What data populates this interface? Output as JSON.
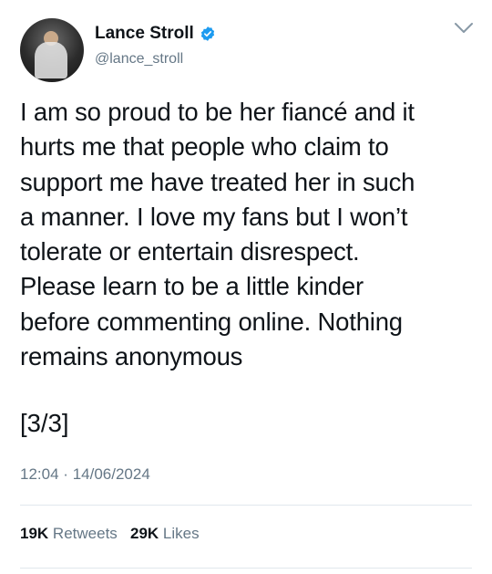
{
  "author": {
    "name": "Lance Stroll",
    "handle": "@lance_stroll",
    "verified_color": "#1d9bf0"
  },
  "tweet": {
    "text": "I am so proud to be her fiancé and it\nhurts me that people who claim to\nsupport me have treated her in such\na manner. I love my fans but I won’t\ntolerate or entertain disrespect.\nPlease learn to be a little kinder\nbefore commenting online. Nothing\nremains anonymous",
    "tag": "[3/3]",
    "time": "12:04",
    "separator": "·",
    "date": "14/06/2024"
  },
  "stats": {
    "retweets_count": "19K",
    "retweets_label": "Retweets",
    "likes_count": "29K",
    "likes_label": "Likes"
  },
  "icons": {
    "verified": "verified-badge-icon",
    "more": "chevron-down-icon"
  }
}
